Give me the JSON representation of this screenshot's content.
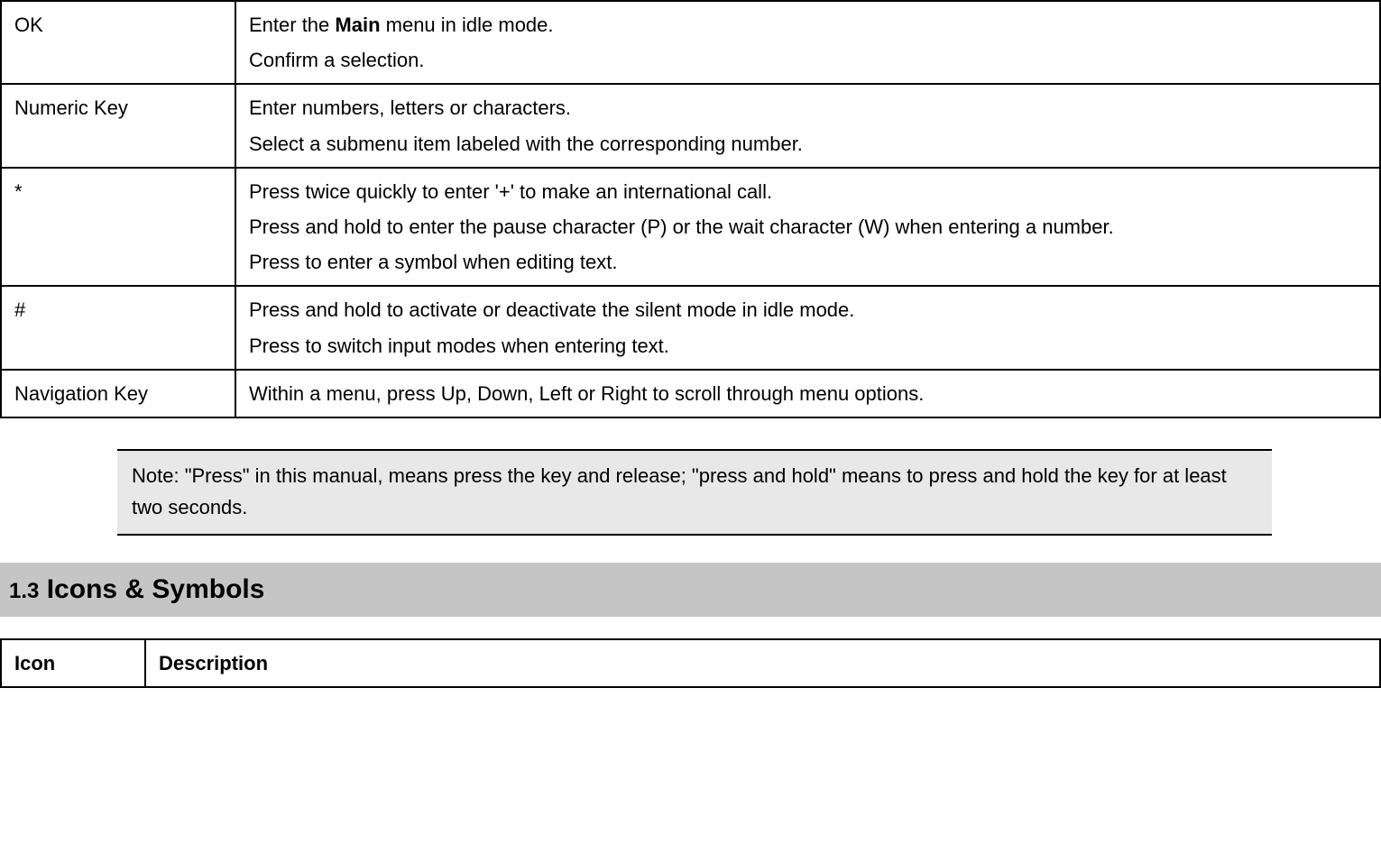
{
  "keys_table": {
    "rows": [
      {
        "key": "OK",
        "lines": [
          {
            "pre": "Enter the ",
            "bold": "Main",
            "post": " menu in idle mode."
          },
          {
            "text": "Confirm a selection."
          }
        ]
      },
      {
        "key": "Numeric Key",
        "lines": [
          {
            "text": "Enter numbers, letters or characters."
          },
          {
            "text": "Select a submenu item labeled with the corresponding number."
          }
        ]
      },
      {
        "key": "*",
        "lines": [
          {
            "text": "Press twice quickly to enter '+' to make an international call."
          },
          {
            "text": "Press and hold to enter the pause character (P) or the wait character (W) when entering a number."
          },
          {
            "text": "Press to enter a symbol when editing text."
          }
        ]
      },
      {
        "key": "#",
        "lines": [
          {
            "text": "Press and hold to activate or deactivate the silent mode in idle mode."
          },
          {
            "text": "Press to switch input modes when entering text."
          }
        ]
      },
      {
        "key": "Navigation Key",
        "lines": [
          {
            "text": "Within a menu, press Up, Down, Left or Right to scroll through menu options."
          }
        ]
      }
    ]
  },
  "note_text": "Note: \"Press\" in this manual, means press the key and release; \"press and hold\" means to press and hold the key for at least two seconds.",
  "section": {
    "number": "1.3",
    "title": "Icons & Symbols"
  },
  "icons_table": {
    "headers": {
      "icon": "Icon",
      "description": "Description"
    }
  }
}
